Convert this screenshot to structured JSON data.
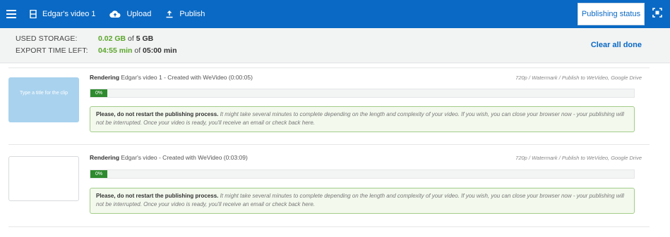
{
  "topbar": {
    "project_title": "Edgar's video 1",
    "upload_label": "Upload",
    "publish_label": "Publish",
    "publishing_status_label": "Publishing status",
    "accent_color": "#0a69c4"
  },
  "storage": {
    "used_label": "USED STORAGE:",
    "used_value": "0.02 GB",
    "used_of": " of ",
    "used_total": "5 GB",
    "export_label": "EXPORT TIME LEFT:",
    "export_value": "04:55 min",
    "export_of": " of ",
    "export_total": "05:00 min",
    "clear_all_label": "Clear all done"
  },
  "jobs": [
    {
      "thumbnail_text": "Type a title for the clip",
      "status_word": "Rendering",
      "title": " Edgar's video 1 - Created with WeVideo (0:00:05)",
      "meta": "720p / Watermark / Publish to WeVideo, Google Drive",
      "progress_label": "0%",
      "progress": 0,
      "notice_bold": "Please, do not restart the publishing process.",
      "notice_text": " It might take several minutes to complete depending on the length and complexity of your video. If you wish, you can close your browser now - your publishing will not be interrupted. Once your video is ready, you'll receive an email or check back here."
    },
    {
      "thumbnail_text": "",
      "status_word": "Rendering",
      "title": " Edgar's video - Created with WeVideo (0:03:09)",
      "meta": "720p / Watermark / Publish to WeVideo, Google Drive",
      "progress_label": "0%",
      "progress": 0,
      "notice_bold": "Please, do not restart the publishing process.",
      "notice_text": " It might take several minutes to complete depending on the length and complexity of your video. If you wish, you can close your browser now - your publishing will not be interrupted. Once your video is ready, you'll receive an email or check back here."
    }
  ]
}
